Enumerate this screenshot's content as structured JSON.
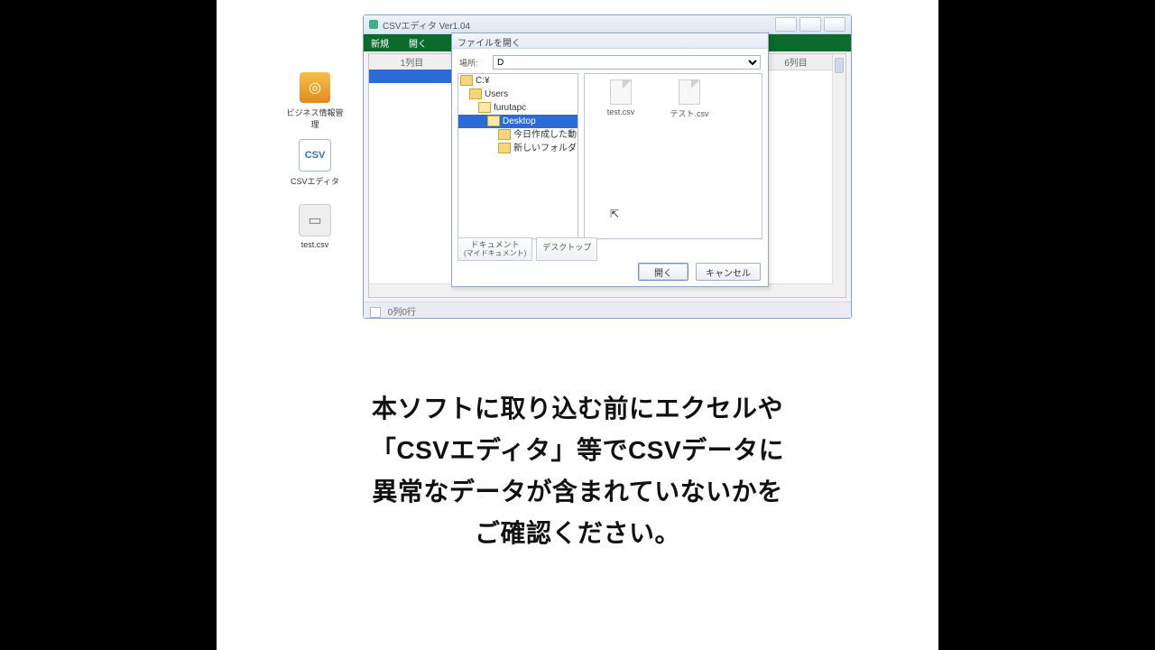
{
  "desktop": {
    "icons": [
      {
        "label": "ビジネス情報管理",
        "symbol": "◎"
      },
      {
        "label": "CSVエディタ",
        "symbol": "CSV"
      },
      {
        "label": "test.csv",
        "symbol": "▭"
      }
    ]
  },
  "app": {
    "title": "CSVエディタ Ver1.04",
    "menu_new": "新規",
    "menu_open": "開く",
    "col_left": "1列目",
    "col_right": "6列目",
    "status": "0列0行"
  },
  "dialog": {
    "title": "ファイルを開く",
    "look_in_label": "場所:",
    "drive": "D",
    "tree": [
      {
        "depth": 0,
        "label": "C:¥",
        "open": false
      },
      {
        "depth": 1,
        "label": "Users",
        "open": false
      },
      {
        "depth": 2,
        "label": "furutapc",
        "open": true
      },
      {
        "depth": 3,
        "label": "Desktop",
        "open": true,
        "selected": true
      },
      {
        "depth": 4,
        "label": "今日作成した動画",
        "open": false
      },
      {
        "depth": 4,
        "label": "新しいフォルダー",
        "open": false
      }
    ],
    "files": [
      {
        "name": "test.csv"
      },
      {
        "name": "テスト.csv"
      }
    ],
    "place_docs_line1": "ドキュメント",
    "place_docs_line2": "(マイドキュメント)",
    "place_desktop": "デスクトップ",
    "btn_open": "開く",
    "btn_cancel": "キャンセル"
  },
  "caption": {
    "l1": "本ソフトに取り込む前にエクセルや",
    "l2": "「CSVエディタ」等でCSVデータに",
    "l3": "異常なデータが含まれていないかを",
    "l4": "ご確認ください。"
  }
}
